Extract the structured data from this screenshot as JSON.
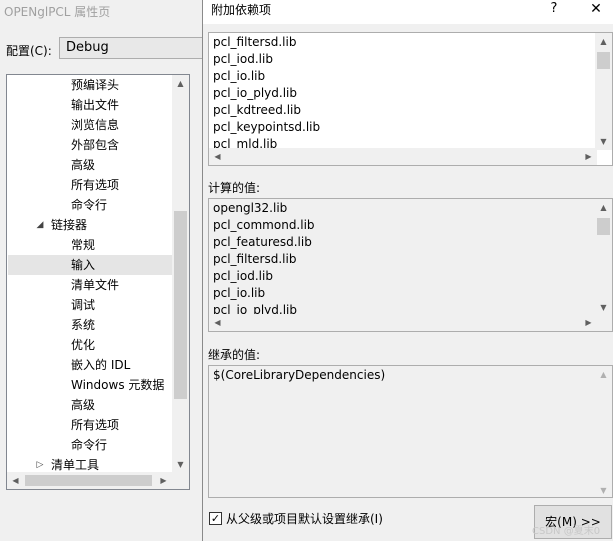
{
  "background_window": {
    "title": "OPENglPCL 属性页",
    "config_label": "配置(C):",
    "config_value": "Debug",
    "tree_items": [
      {
        "label": "预编译头",
        "indent": 2
      },
      {
        "label": "输出文件",
        "indent": 2
      },
      {
        "label": "浏览信息",
        "indent": 2
      },
      {
        "label": "外部包含",
        "indent": 2
      },
      {
        "label": "高级",
        "indent": 2
      },
      {
        "label": "所有选项",
        "indent": 2
      },
      {
        "label": "命令行",
        "indent": 2
      },
      {
        "label": "链接器",
        "indent": 1,
        "arrow": "◢"
      },
      {
        "label": "常规",
        "indent": 2
      },
      {
        "label": "输入",
        "indent": 2,
        "selected": true
      },
      {
        "label": "清单文件",
        "indent": 2
      },
      {
        "label": "调试",
        "indent": 2
      },
      {
        "label": "系统",
        "indent": 2
      },
      {
        "label": "优化",
        "indent": 2
      },
      {
        "label": "嵌入的 IDL",
        "indent": 2
      },
      {
        "label": "Windows 元数据",
        "indent": 2
      },
      {
        "label": "高级",
        "indent": 2
      },
      {
        "label": "所有选项",
        "indent": 2
      },
      {
        "label": "命令行",
        "indent": 2
      },
      {
        "label": "清单工具",
        "indent": 1,
        "arrow": "▷"
      }
    ]
  },
  "dialog": {
    "title": "附加依赖项",
    "help_label": "?",
    "close_label": "✕",
    "edit_lines": [
      "pcl_filtersd.lib",
      "pcl_iod.lib",
      "pcl_io.lib",
      "pcl_io_plyd.lib",
      "pcl_kdtreed.lib",
      "pcl_keypointsd.lib",
      "pcl_mld.lib"
    ],
    "computed_label": "计算的值:",
    "computed_lines": [
      "opengl32.lib",
      "pcl_commond.lib",
      "pcl_featuresd.lib",
      "pcl_filtersd.lib",
      "pcl_iod.lib",
      "pcl_io.lib",
      "pcl_io_plyd.lib"
    ],
    "inherited_label": "继承的值:",
    "inherited_lines": [
      "$(CoreLibraryDependencies)"
    ],
    "inherit_checkbox_checked": true,
    "inherit_checkbox_label": "从父级或项目默认设置继承(I)",
    "macro_button_label": "宏(M) >>"
  },
  "watermark": "CSDN @夏末0",
  "icons": {
    "scroll_up": "▲",
    "scroll_down": "▼",
    "scroll_left": "◀",
    "scroll_right": "▶",
    "check": "✓"
  }
}
